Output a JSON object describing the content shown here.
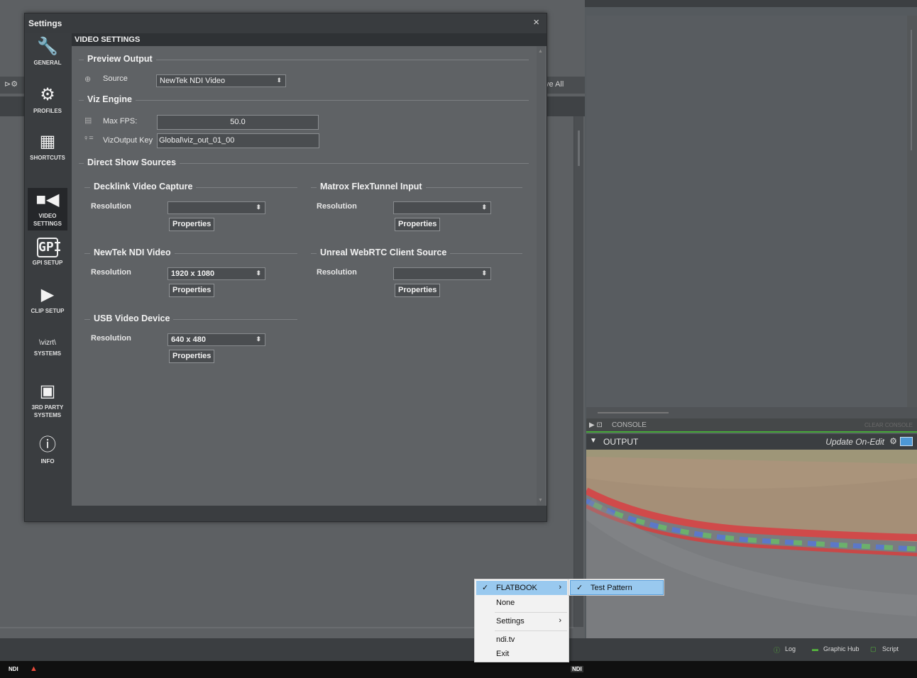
{
  "background": {
    "save_all": "ve All",
    "console_label": "CONSOLE",
    "clear_console": "CLEAR CONSOLE",
    "output_label": "OUTPUT",
    "update_mode": "Update On-Edit",
    "status": {
      "log": "Log",
      "graphic_hub": "Graphic Hub",
      "script": "Script"
    }
  },
  "dialog": {
    "title": "Settings",
    "close": "×",
    "section_header": "VIDEO SETTINGS",
    "sidebar": [
      {
        "label": "GENERAL",
        "icon": "wrench-icon",
        "glyph": "🔧"
      },
      {
        "label": "PROFILES",
        "icon": "gear-window-icon",
        "glyph": "⚙"
      },
      {
        "label": "SHORTCUTS",
        "icon": "keyboard-icon",
        "glyph": "▦"
      },
      {
        "label": "VIDEO",
        "label2": "SETTINGS",
        "icon": "video-camera-icon",
        "glyph": "■"
      },
      {
        "label": "GPI SETUP",
        "icon": "gpi-icon",
        "glyph": "GPI"
      },
      {
        "label": "CLIP SETUP",
        "icon": "clapperboard-icon",
        "glyph": "▶"
      },
      {
        "label": "SYSTEMS",
        "icon": "vizrt-logo-icon",
        "glyph": "\\vizrt\\"
      },
      {
        "label": "3RD PARTY",
        "label2": "SYSTEMS",
        "icon": "picture-icon",
        "glyph": "▣"
      },
      {
        "label": "INFO",
        "icon": "info-icon",
        "glyph": "ⓘ"
      }
    ],
    "preview_output": {
      "heading": "Preview Output",
      "source_label": "Source",
      "source_value": "NewTek NDI Video"
    },
    "viz_engine": {
      "heading": "Viz Engine",
      "max_fps_label": "Max FPS:",
      "max_fps_value": "50.0",
      "output_key_label": "VizOutput Key",
      "output_key_value": "Global\\viz_out_01_00"
    },
    "direct_show": {
      "heading": "Direct Show Sources",
      "resolution_label": "Resolution",
      "properties_label": "Properties",
      "sources": [
        {
          "name": "Decklink Video Capture",
          "resolution": ""
        },
        {
          "name": "Matrox FlexTunnel Input",
          "resolution": ""
        },
        {
          "name": "NewTek NDI Video",
          "resolution": "1920 x 1080"
        },
        {
          "name": "Unreal WebRTC Client Source",
          "resolution": ""
        },
        {
          "name": "USB Video Device",
          "resolution": "640 x 480"
        }
      ]
    }
  },
  "context_menu": {
    "items": [
      {
        "label": "FLATBOOK",
        "checked": true,
        "submenu": true
      },
      {
        "label": "None"
      },
      {
        "label": "Settings",
        "submenu": true
      },
      {
        "label": "ndi.tv"
      },
      {
        "label": "Exit"
      }
    ],
    "submenu": [
      {
        "label": "Test Pattern",
        "checked": true
      }
    ]
  },
  "taskbar": {
    "ndi": "NDI"
  }
}
